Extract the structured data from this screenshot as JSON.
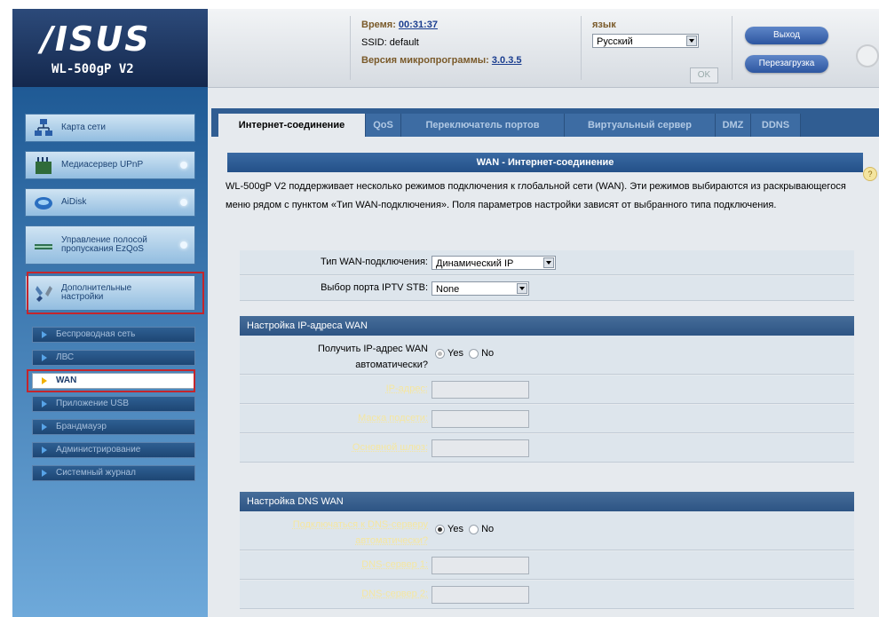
{
  "brand": {
    "logo": "/ISUS",
    "model": "WL-500gP V2"
  },
  "header": {
    "time_label": "Время:",
    "time_value": "00:31:37",
    "ssid_label": "SSID:",
    "ssid_value": "default",
    "fw_label": "Версия микропрограммы:",
    "fw_value": "3.0.3.5",
    "lang_label": "язык",
    "lang_value": "Русский",
    "ok_label": "OK",
    "logout_label": "Выход",
    "reboot_label": "Перезагрузка"
  },
  "sidebar": {
    "items": [
      {
        "label": "Карта сети",
        "icon": "network-map-icon"
      },
      {
        "label": "Медиасервер UPnP",
        "icon": "media-server-icon"
      },
      {
        "label": "AiDisk",
        "icon": "aidisk-icon"
      },
      {
        "label": "Управление полосой пропускания EzQoS",
        "icon": "bandwidth-icon"
      },
      {
        "label": "Дополнительные настройки",
        "icon": "tools-icon"
      }
    ],
    "sub_items": [
      {
        "label": "Беспроводная сеть"
      },
      {
        "label": "ЛВС"
      },
      {
        "label": "WAN"
      },
      {
        "label": "Приложение USB"
      },
      {
        "label": "Брандмауэр"
      },
      {
        "label": "Администрирование"
      },
      {
        "label": "Системный журнал"
      }
    ]
  },
  "tabs": [
    "Интернет-соединение",
    "QoS",
    "Переключатель портов",
    "Виртуальный сервер",
    "DMZ",
    "DDNS"
  ],
  "main": {
    "title": "WAN - Интернет-соединение",
    "description": "WL-500gP V2 поддерживает несколько режимов подключения к глобальной сети (WAN). Эти режимов выбираются из раскрывающегося меню рядом с пунктом «Тип WAN-подключения». Поля параметров настройки зависят от выбранного типа подключения.",
    "wan_type_label": "Тип WAN-подключения:",
    "wan_type_value": "Динамический IP",
    "iptv_label": "Выбор порта IPTV STB:",
    "iptv_value": "None",
    "ip_section": "Настройка IP-адреса WAN",
    "auto_ip_label": "Получить IP-адрес WAN автоматически?",
    "yes_label": "Yes",
    "no_label": "No",
    "ip_label": "IP-адрес:",
    "mask_label": "Маска подсети:",
    "gateway_label": "Основной шлюз:",
    "dns_section": "Настройка DNS WAN",
    "auto_dns_label": "Подключаться к DNS-серверу автоматически?",
    "dns1_label": "DNS-сервер 1:",
    "dns2_label": "DNS-сервер 2:"
  },
  "colors": {
    "accent": "#305d92",
    "highlight": "#c4252c"
  }
}
